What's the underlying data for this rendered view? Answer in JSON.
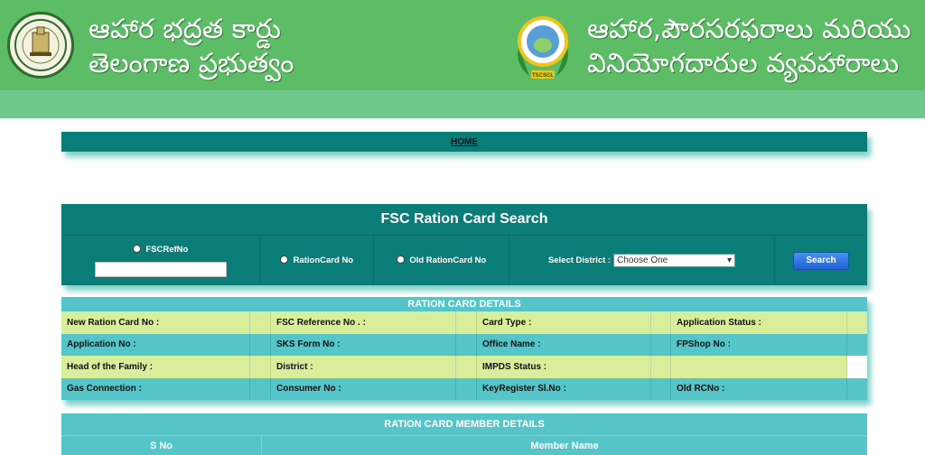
{
  "header": {
    "title_left_line1": "ఆహార భద్రత కార్డు",
    "title_left_line2": "తెలంగాణ ప్రభుత్వం",
    "title_right_line1": "ఆహార,పౌరసరఫరాలు మరియు",
    "title_right_line2": "వినియోగదారుల వ్యవహారాలు",
    "logo_left_icon": "telangana-emblem-icon",
    "logo_right_icon": "tscscl-logo-icon",
    "logo_right_text": "TSCSCL"
  },
  "nav": {
    "home_label": "HOME"
  },
  "search": {
    "title": "FSC Ration Card Search",
    "option_fscref": "FSCRefNo",
    "option_rationcard": "RationCard No",
    "option_old_rationcard": "Old RationCard No",
    "district_label": "Select District :",
    "district_selected": "Choose One",
    "search_button": "Search"
  },
  "details": {
    "heading": "RATION CARD DETAILS",
    "rows": [
      [
        "New Ration Card No :",
        "FSC Reference No . :",
        "Card Type :",
        "Application Status :"
      ],
      [
        "Application No :",
        "SKS Form No :",
        "Office Name :",
        "FPShop No :"
      ],
      [
        "Head of the Family :",
        "District :",
        "IMPDS Status :",
        ""
      ],
      [
        "Gas Connection :",
        "Consumer No :",
        "KeyRegister Sl.No :",
        "Old RCNo :"
      ]
    ]
  },
  "members": {
    "heading": "RATION CARD MEMBER DETAILS",
    "col_sno": "S No",
    "col_name": "Member Name"
  },
  "colors": {
    "header_green": "#5cbd66",
    "panel_teal": "#0b7d78",
    "row_lime": "#d8ee9a",
    "row_teal": "#56c5c9",
    "button_blue": "#1e63d6"
  }
}
